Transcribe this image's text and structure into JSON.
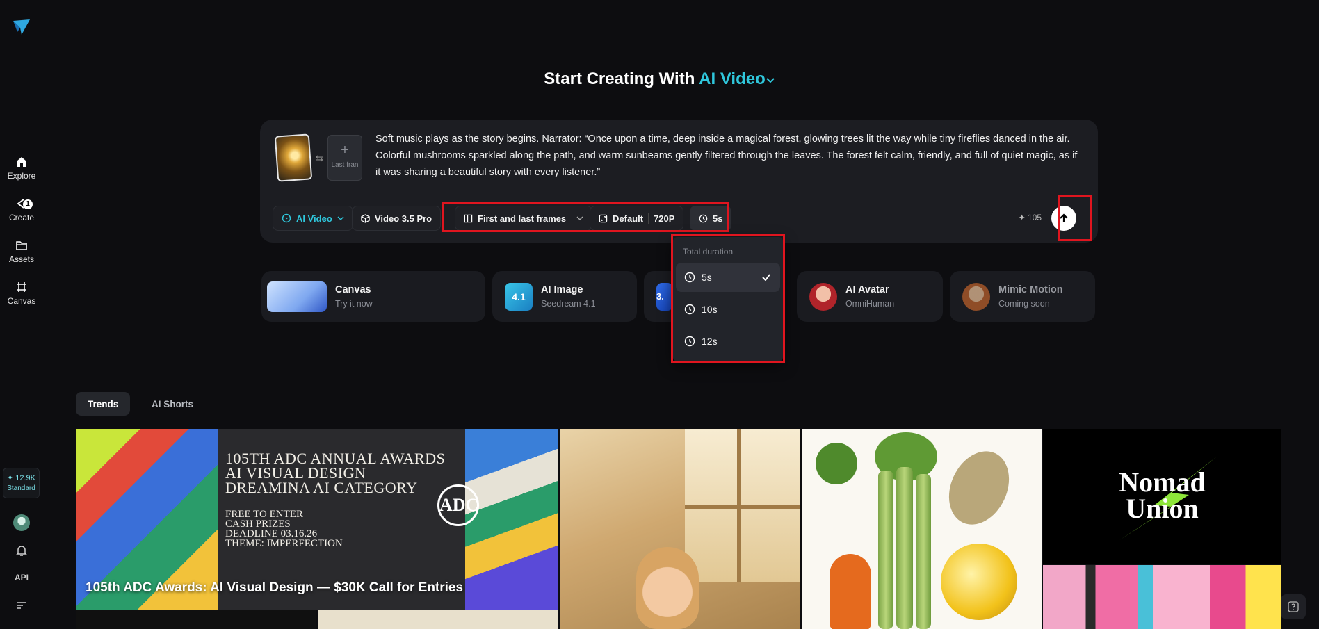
{
  "sidebar": {
    "items": [
      {
        "label": "Explore",
        "icon": "home-icon"
      },
      {
        "label": "Create",
        "icon": "create-icon",
        "badge": "1"
      },
      {
        "label": "Assets",
        "icon": "folder-icon"
      },
      {
        "label": "Canvas",
        "icon": "canvas-icon"
      }
    ],
    "credits": "✦ 12.9K",
    "plan": "Standard",
    "api_label": "API"
  },
  "headline": {
    "prefix": "Start Creating With",
    "mode": "AI Video"
  },
  "prompt": {
    "text": "Soft music plays as the story begins. Narrator: “Once upon a time, deep inside a magical forest, glowing trees lit the way while tiny fireflies danced in the air. Colorful mushrooms sparkled along the path, and warm sunbeams gently filtered through the leaves. The forest felt calm, friendly, and full of quiet magic, as if it was sharing a beautiful story with every listener.”",
    "last_frame_label": "Last fran"
  },
  "toolbar": {
    "mode": "AI Video",
    "model": "Video 3.5 Pro",
    "frames": "First and last frames",
    "ratio": "Default",
    "resolution": "720P",
    "duration": "5s",
    "cost": "✦ 105"
  },
  "duration_menu": {
    "title": "Total duration",
    "options": [
      "5s",
      "10s",
      "12s"
    ],
    "selected": "5s"
  },
  "features": [
    {
      "title": "Canvas",
      "subtitle": "Try it now"
    },
    {
      "title": "AI Image",
      "subtitle": "Seedream 4.1",
      "icon_text": "4.1"
    },
    {
      "title": "",
      "subtitle": "",
      "icon_text": "3."
    },
    {
      "title": "AI Avatar",
      "subtitle": "OmniHuman"
    },
    {
      "title": "Mimic Motion",
      "subtitle": "Coming soon"
    }
  ],
  "tabs": [
    "Trends",
    "AI Shorts"
  ],
  "gallery": {
    "adc": {
      "lines": [
        "105TH ADC ANNUAL AWARDS",
        "AI VISUAL DESIGN",
        "DREAMINA AI CATEGORY"
      ],
      "details": [
        "FREE TO ENTER",
        "CASH PRIZES",
        "DEADLINE 03.16.26",
        "THEME: IMPERFECTION"
      ],
      "seal": "ADC",
      "caption": "105th ADC Awards: AI Visual Design — $30K Call for Entries"
    },
    "nomad": {
      "line1": "Nomad",
      "line2": "Union"
    }
  },
  "colors": {
    "accent": "#2fc7dc",
    "highlight": "#e0151f",
    "background": "#0d0d10",
    "card": "#1c1d22"
  }
}
